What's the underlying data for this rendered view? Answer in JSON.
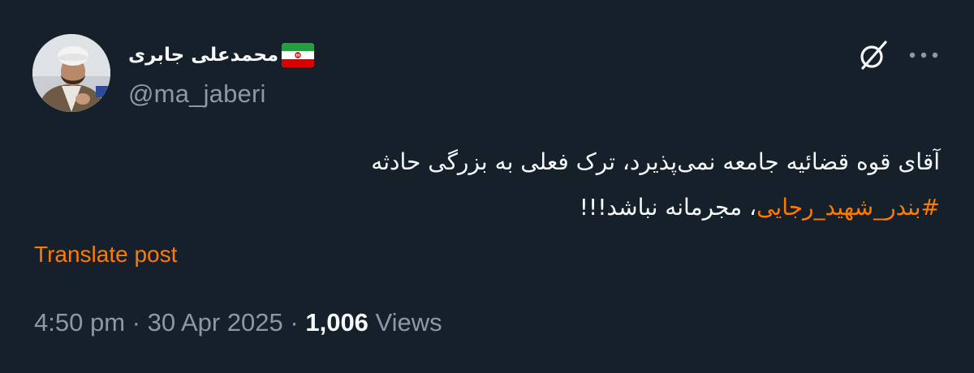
{
  "author": {
    "display_name": "محمدعلی جابری",
    "handle": "@ma_jaberi",
    "flag_icon": "iran-flag-icon",
    "avatar_icon": "profile-photo"
  },
  "actions": {
    "grok_icon": "grok-icon",
    "more_icon": "more-options-icon"
  },
  "post": {
    "line1": "آقای قوه قضائیه جامعه نمی‌پذیرد، ترک فعلی به بزرگی حادثه",
    "hashtag": "#بندر_شهید_رجایی",
    "line2_rest": "، مجرمانه نباشد!!!",
    "translate_label": "Translate post"
  },
  "meta": {
    "time": "4:50 pm",
    "sep1": " · ",
    "date": "30 Apr 2025",
    "sep2": " · ",
    "views_count": "1,006",
    "views_label": " Views"
  },
  "colors": {
    "background": "#15202b",
    "text": "#f7f9f9",
    "secondary": "#8b98a5",
    "accent": "#ff7a00"
  }
}
